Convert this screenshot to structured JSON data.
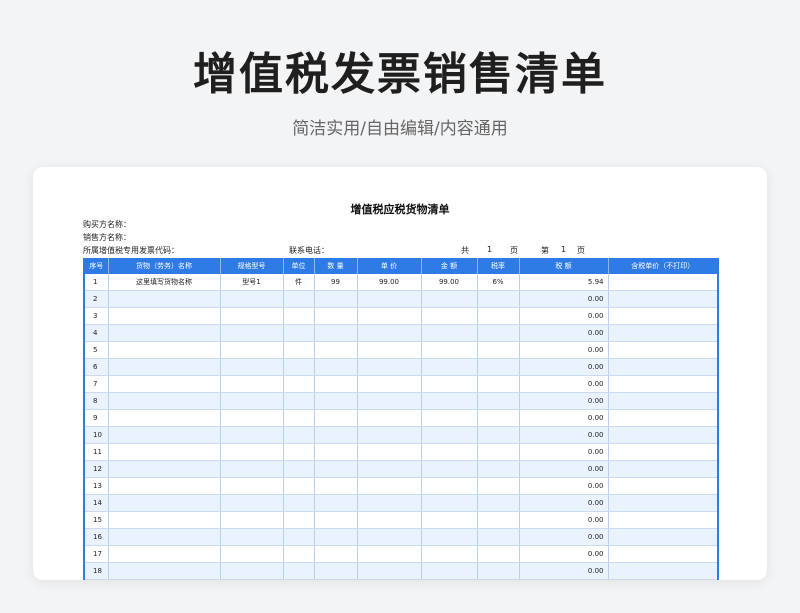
{
  "header": {
    "title": "增值税发票销售清单",
    "subtitle": "简洁实用/自由编辑/内容通用"
  },
  "sheet": {
    "title": "增值税应税货物清单",
    "buyer_label": "购买方名称：",
    "seller_label": "销售方名称：",
    "invoice_code_label": "所属增值税专用发票代码：",
    "phone_label": "联系电话：",
    "total_pages_label": "共",
    "total_pages": "1",
    "page_unit": "页",
    "current_page_label": "第",
    "current_page": "1",
    "current_page_unit": "页"
  },
  "table": {
    "columns": [
      "序号",
      "货物（劳务）名称",
      "规格型号",
      "单位",
      "数 量",
      "单 价",
      "金 额",
      "税率",
      "税 额",
      "含税单价（不打印）"
    ],
    "rows": [
      [
        "1",
        "这里填写货物名称",
        "型号1",
        "件",
        "99",
        "99.00",
        "99.00",
        "6%",
        "5.94",
        ""
      ],
      [
        "2",
        "",
        "",
        "",
        "",
        "",
        "",
        "",
        "0.00",
        ""
      ],
      [
        "3",
        "",
        "",
        "",
        "",
        "",
        "",
        "",
        "0.00",
        ""
      ],
      [
        "4",
        "",
        "",
        "",
        "",
        "",
        "",
        "",
        "0.00",
        ""
      ],
      [
        "5",
        "",
        "",
        "",
        "",
        "",
        "",
        "",
        "0.00",
        ""
      ],
      [
        "6",
        "",
        "",
        "",
        "",
        "",
        "",
        "",
        "0.00",
        ""
      ],
      [
        "7",
        "",
        "",
        "",
        "",
        "",
        "",
        "",
        "0.00",
        ""
      ],
      [
        "8",
        "",
        "",
        "",
        "",
        "",
        "",
        "",
        "0.00",
        ""
      ],
      [
        "9",
        "",
        "",
        "",
        "",
        "",
        "",
        "",
        "0.00",
        ""
      ],
      [
        "10",
        "",
        "",
        "",
        "",
        "",
        "",
        "",
        "0.00",
        ""
      ],
      [
        "11",
        "",
        "",
        "",
        "",
        "",
        "",
        "",
        "0.00",
        ""
      ],
      [
        "12",
        "",
        "",
        "",
        "",
        "",
        "",
        "",
        "0.00",
        ""
      ],
      [
        "13",
        "",
        "",
        "",
        "",
        "",
        "",
        "",
        "0.00",
        ""
      ],
      [
        "14",
        "",
        "",
        "",
        "",
        "",
        "",
        "",
        "0.00",
        ""
      ],
      [
        "15",
        "",
        "",
        "",
        "",
        "",
        "",
        "",
        "0.00",
        ""
      ],
      [
        "16",
        "",
        "",
        "",
        "",
        "",
        "",
        "",
        "0.00",
        ""
      ],
      [
        "17",
        "",
        "",
        "",
        "",
        "",
        "",
        "",
        "0.00",
        ""
      ],
      [
        "18",
        "",
        "",
        "",
        "",
        "",
        "",
        "",
        "0.00",
        ""
      ]
    ]
  },
  "colors": {
    "header_blue": "#2f7be6",
    "row_stripe": "#eaf2fd"
  }
}
